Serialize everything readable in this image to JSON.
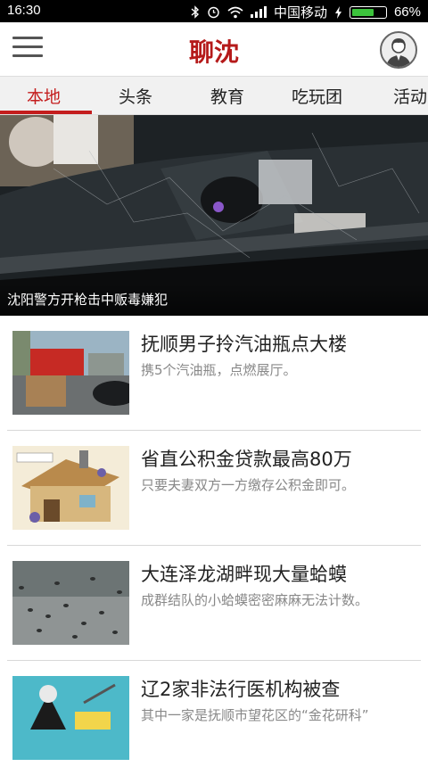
{
  "status_bar": {
    "time": "16:30",
    "carrier": "中国移动",
    "battery": "66%",
    "battery_level": 0.66,
    "icons": [
      "bluetooth-icon",
      "alarm-icon",
      "wifi-icon",
      "signal-icon",
      "charging-icon",
      "battery-icon"
    ]
  },
  "header": {
    "title": "聊沈",
    "menu_icon": "hamburger-menu-icon",
    "avatar_icon": "user-avatar-icon",
    "title_color": "#b51a1a"
  },
  "tabs": [
    {
      "label": "本地",
      "active": true
    },
    {
      "label": "头条",
      "active": false
    },
    {
      "label": "教育",
      "active": false
    },
    {
      "label": "吃玩团",
      "active": false
    },
    {
      "label": "活动",
      "active": false
    }
  ],
  "accent_color": "#c41d1d",
  "hero": {
    "caption": "沈阳警方开枪击中贩毒嫌犯"
  },
  "news": [
    {
      "title": "抚顺男子拎汽油瓶点大楼",
      "desc": "携5个汽油瓶，点燃展厅。"
    },
    {
      "title": "省直公积金贷款最高80万",
      "desc": "只要夫妻双方一方缴存公积金即可。"
    },
    {
      "title": "大连泽龙湖畔现大量蛤蟆",
      "desc": "成群结队的小蛤蟆密密麻麻无法计数。"
    },
    {
      "title": "辽2家非法行医机构被查",
      "desc": "其中一家是抚顺市望花区的“金花研科”"
    }
  ]
}
